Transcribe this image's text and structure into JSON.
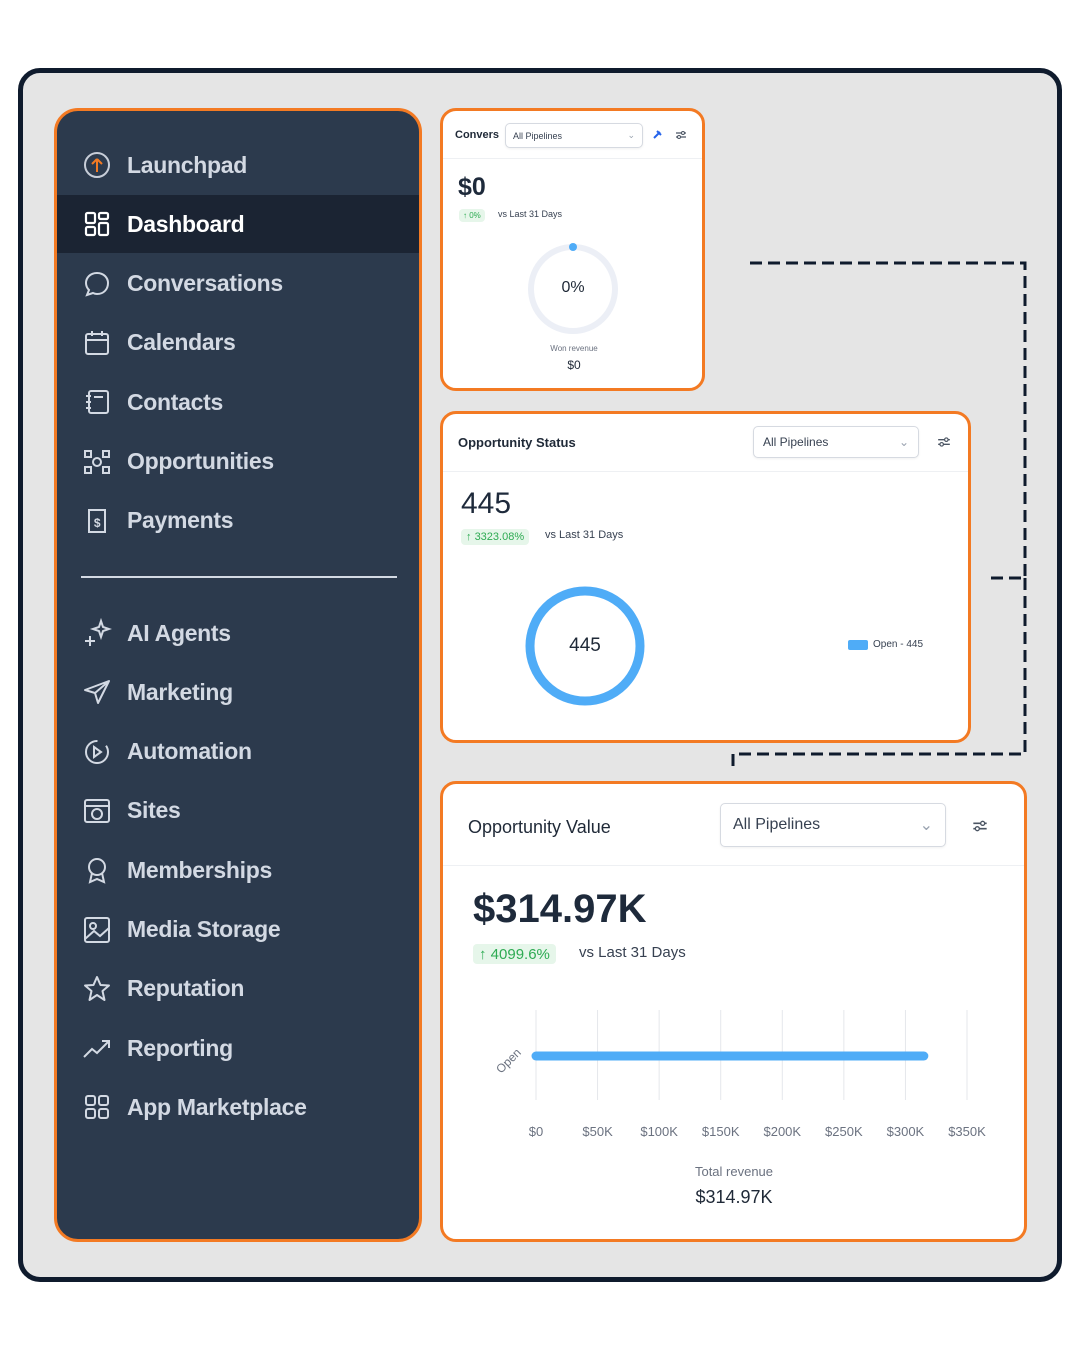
{
  "sidebar": {
    "items": [
      {
        "label": "Launchpad",
        "icon": "launchpad-icon",
        "active": false
      },
      {
        "label": "Dashboard",
        "icon": "dashboard-icon",
        "active": true
      },
      {
        "label": "Conversations",
        "icon": "chat-bubble-icon",
        "active": false
      },
      {
        "label": "Calendars",
        "icon": "calendar-icon",
        "active": false
      },
      {
        "label": "Contacts",
        "icon": "contacts-icon",
        "active": false
      },
      {
        "label": "Opportunities",
        "icon": "opportunities-icon",
        "active": false
      },
      {
        "label": "Payments",
        "icon": "payments-icon",
        "active": false
      }
    ],
    "items2": [
      {
        "label": "AI Agents",
        "icon": "sparkle-icon"
      },
      {
        "label": "Marketing",
        "icon": "send-icon"
      },
      {
        "label": "Automation",
        "icon": "automation-icon"
      },
      {
        "label": "Sites",
        "icon": "sites-icon"
      },
      {
        "label": "Memberships",
        "icon": "award-icon"
      },
      {
        "label": "Media Storage",
        "icon": "image-icon"
      },
      {
        "label": "Reputation",
        "icon": "star-icon"
      },
      {
        "label": "Reporting",
        "icon": "trend-icon"
      },
      {
        "label": "App Marketplace",
        "icon": "grid-icon"
      }
    ]
  },
  "conversion_card": {
    "title": "Convers",
    "pipeline_select": "All Pipelines",
    "value": "$0",
    "change": "0%",
    "vs_label": "vs Last 31 Days",
    "ring_label": "0%",
    "won_revenue_label": "Won revenue",
    "won_revenue_value": "$0"
  },
  "status_card": {
    "title": "Opportunity Status",
    "pipeline_select": "All Pipelines",
    "value": "445",
    "change": "3323.08%",
    "vs_label": "vs Last 31 Days",
    "donut_label": "445",
    "legend": "Open - 445"
  },
  "value_card": {
    "title": "Opportunity Value",
    "pipeline_select": "All Pipelines",
    "value": "$314.97K",
    "change": "4099.6%",
    "vs_label": "vs Last 31 Days",
    "total_revenue_label": "Total revenue",
    "total_revenue_value": "$314.97K"
  },
  "chart_data": {
    "type": "bar",
    "orientation": "horizontal",
    "categories": [
      "Open"
    ],
    "values": [
      314970
    ],
    "x_ticks": [
      "$0",
      "$50K",
      "$100K",
      "$150K",
      "$200K",
      "$250K",
      "$300K",
      "$350K"
    ],
    "xlim": [
      0,
      350000
    ],
    "color": "#4facf7"
  },
  "colors": {
    "accent_orange": "#f37a23",
    "sidebar_bg": "#2c3a4d",
    "chart_blue": "#4facf7",
    "positive_green": "#2eab53"
  }
}
